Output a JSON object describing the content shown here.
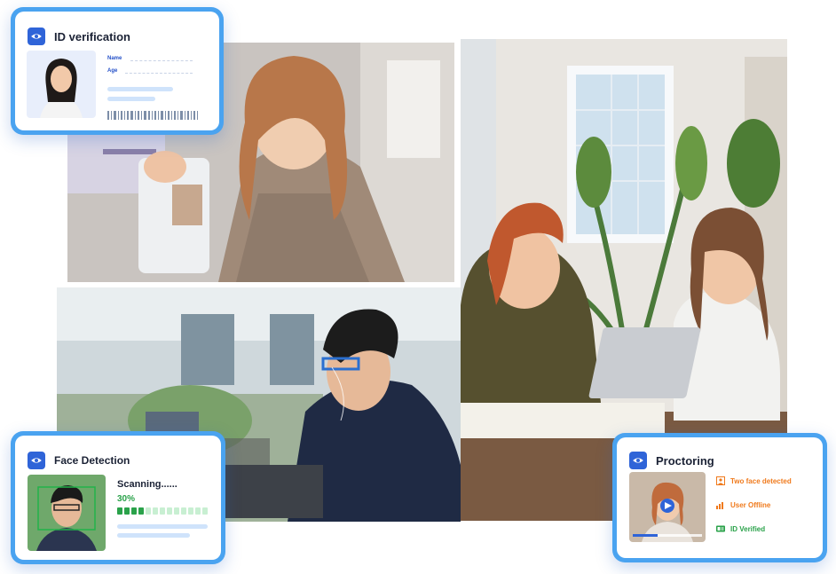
{
  "id_card": {
    "title": "ID verification",
    "name_label": "Name",
    "age_label": "Age",
    "icon": "eye-icon"
  },
  "face_card": {
    "title": "Face Detection",
    "status": "Scanning......",
    "progress_text": "30%",
    "progress": 0.3,
    "icon": "eye-icon"
  },
  "proctor_card": {
    "title": "Proctoring",
    "alerts": [
      {
        "label": "Two face detected",
        "icon": "person-icon",
        "color": "#f07a1c"
      },
      {
        "label": "User Offline",
        "icon": "signal-icon",
        "color": "#f07a1c"
      },
      {
        "label": "ID Verified",
        "icon": "id-card-icon",
        "color": "#2aa24a"
      }
    ],
    "icon": "eye-icon"
  },
  "colors": {
    "accent": "#2f64d8",
    "card_border": "#4aa3f0",
    "success": "#2aa24a",
    "warning": "#f07a1c"
  }
}
